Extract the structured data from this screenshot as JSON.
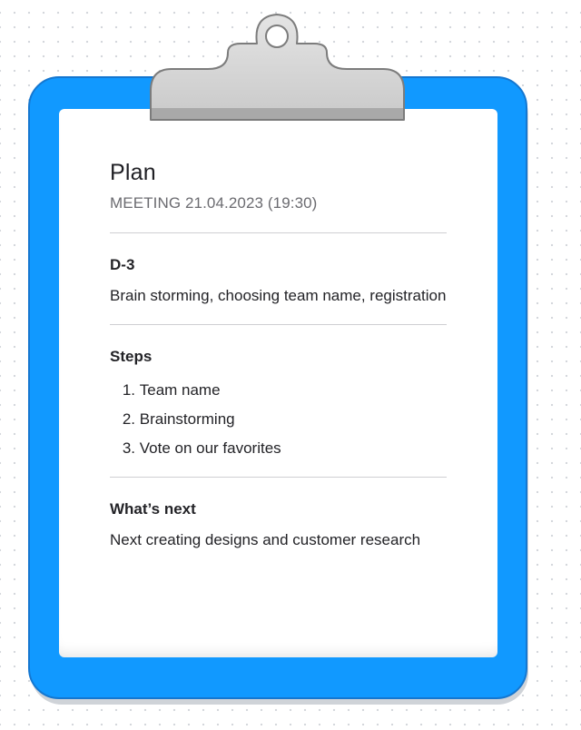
{
  "note": {
    "title": "Plan",
    "subtitle": "MEETING 21.04.2023 (19:30)",
    "sections": [
      {
        "heading": "D-3",
        "text": "Brain storming, choosing team name, registration"
      },
      {
        "heading": "Steps",
        "items": [
          {
            "num": "1.",
            "text": "Team name"
          },
          {
            "num": "2.",
            "text": "Brainstorming"
          },
          {
            "num": "3.",
            "text": "Vote on our favorites"
          }
        ]
      },
      {
        "heading": "What’s next",
        "text": "Next creating designs and customer research"
      }
    ]
  },
  "colors": {
    "board": "#1199ff",
    "board_border": "#1577d0",
    "clip": "#d6d6d6",
    "paper": "#ffffff"
  },
  "icons": {
    "clip": "clipboard-clip-icon"
  }
}
